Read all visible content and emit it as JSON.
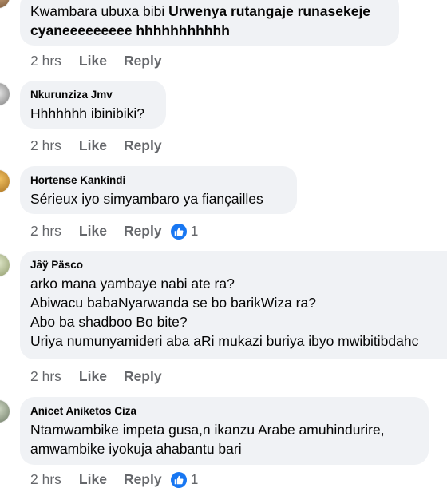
{
  "colors": {
    "bubble": "#f0f2f5",
    "meta": "#65676b",
    "like_blue": "#1877f2"
  },
  "comments": [
    {
      "name": "",
      "line1_plain": "Kwambara ubuxa bibi ",
      "line1_bold": "Urwenya rutangaje runasekeje",
      "line2_bold": "cyaneeeeeeeee hhhhhhhhhhh",
      "time": "2 hrs",
      "like": "Like",
      "reply": "Reply"
    },
    {
      "name": "Nkurunziza Jmv",
      "lines": [
        "Hhhhhhh ibinibiki?"
      ],
      "time": "2 hrs",
      "like": "Like",
      "reply": "Reply"
    },
    {
      "name": "Hortense Kankindi",
      "lines": [
        "Sérieux iyo simyambaro ya fiançailles"
      ],
      "time": "2 hrs",
      "like": "Like",
      "reply": "Reply",
      "reactions": "1"
    },
    {
      "name": "Jâÿ Päsco",
      "lines": [
        "arko mana yambaye nabi ate ra?",
        "Abiwacu babaNyarwanda se bo barikWiza ra?",
        "Abo ba shadboo Bo bite?",
        "Uriya numunyamideri aba aRi mukazi buriya ibyo mwibitibdahc"
      ],
      "time": "2 hrs",
      "like": "Like",
      "reply": "Reply"
    },
    {
      "name": "Anicet Aniketos Ciza",
      "lines": [
        "Ntamwambike impeta gusa,n ikanzu Arabe amuhindurire,",
        "amwambike iyokuja ahabantu bari"
      ],
      "time": "2 hrs",
      "like": "Like",
      "reply": "Reply",
      "reactions": "1"
    }
  ]
}
